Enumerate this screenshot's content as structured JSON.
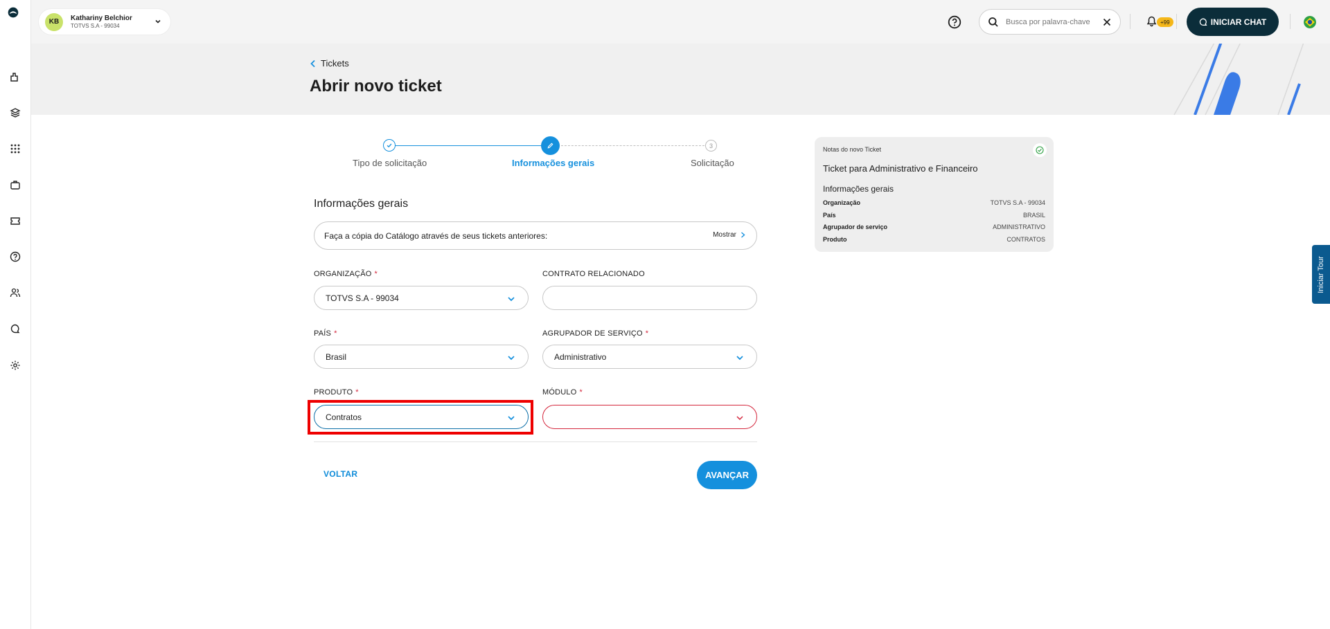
{
  "header": {
    "user": {
      "initials": "KB",
      "name": "Kathariny Belchior",
      "org": "TOTVS S.A - 99034"
    },
    "search": {
      "placeholder": "Busca por palavra-chave"
    },
    "notifications_badge": "+99",
    "chat_button": "INICIAR CHAT"
  },
  "sidebar": {
    "icons": [
      "home-icon",
      "layers-icon",
      "apps-grid-icon",
      "briefcase-icon",
      "ticket-icon",
      "help-icon",
      "users-icon",
      "chat-icon",
      "settings-icon"
    ]
  },
  "page": {
    "breadcrumb": "Tickets",
    "title": "Abrir novo ticket"
  },
  "stepper": {
    "steps": [
      {
        "label": "Tipo de solicitação",
        "state": "done"
      },
      {
        "label": "Informações gerais",
        "state": "active"
      },
      {
        "label": "Solicitação",
        "state": "pending",
        "number": "3"
      }
    ]
  },
  "form": {
    "section_title": "Informações gerais",
    "copy_catalog": {
      "text": "Faça a cópia do Catálogo através de seus tickets anteriores:",
      "link": "Mostrar"
    },
    "fields": {
      "organizacao": {
        "label": "ORGANIZAÇÃO",
        "required": "*",
        "value": "TOTVS S.A - 99034"
      },
      "contrato": {
        "label": "CONTRATO RELACIONADO",
        "value": ""
      },
      "pais": {
        "label": "PAÍS",
        "required": "*",
        "value": "Brasil"
      },
      "agrupador": {
        "label": "AGRUPADOR DE SERVIÇO",
        "required": "*",
        "value": "Administrativo"
      },
      "produto": {
        "label": "PRODUTO",
        "required": "*",
        "value": "Contratos"
      },
      "modulo": {
        "label": "MÓDULO",
        "required": "*",
        "value": ""
      }
    },
    "back_button": "VOLTAR",
    "next_button": "AVANÇAR"
  },
  "notes": {
    "title": "Notas do novo Ticket",
    "heading": "Ticket para Administrativo e Financeiro",
    "subheading": "Informações gerais",
    "rows": [
      {
        "key": "Organização",
        "value": "TOTVS S.A - 99034"
      },
      {
        "key": "País",
        "value": "BRASIL"
      },
      {
        "key": "Agrupador de serviço",
        "value": "ADMINISTRATIVO"
      },
      {
        "key": "Produto",
        "value": "CONTRATOS"
      }
    ]
  },
  "tour_tab": "Iniciar Tour",
  "colors": {
    "primary": "#1590dd",
    "dark": "#0b2d3a",
    "error": "#d4263c",
    "highlight": "#ee0000",
    "badge": "#f5b719"
  }
}
